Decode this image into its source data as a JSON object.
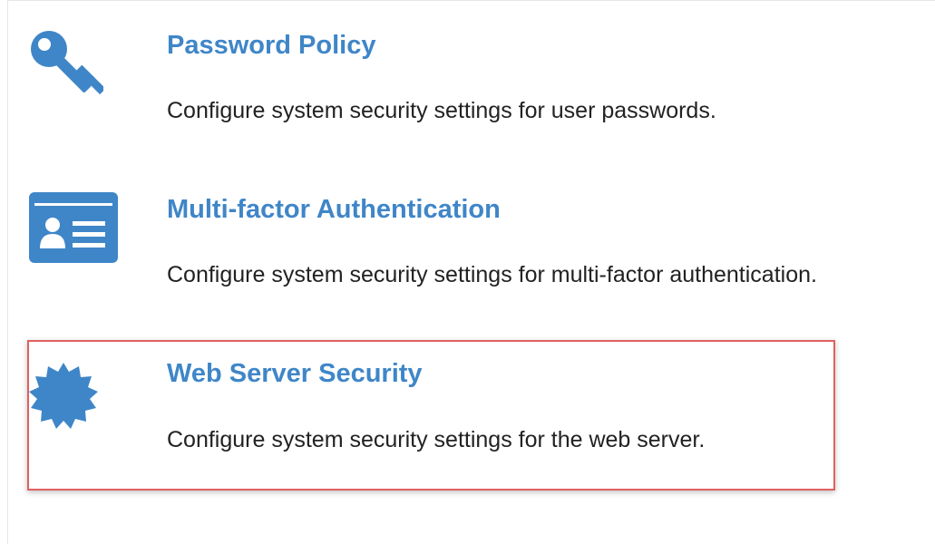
{
  "accent_color": "#3f86c8",
  "highlight_color": "#e06060",
  "items": [
    {
      "icon": "key-icon",
      "title": "Password Policy",
      "description": "Configure system security settings for user passwords."
    },
    {
      "icon": "id-card-icon",
      "title": "Multi-factor Authentication",
      "description": "Configure system security settings for multi-factor authentication."
    },
    {
      "icon": "certificate-badge-icon",
      "title": "Web Server Security",
      "description": "Configure system security settings for the web server."
    }
  ]
}
